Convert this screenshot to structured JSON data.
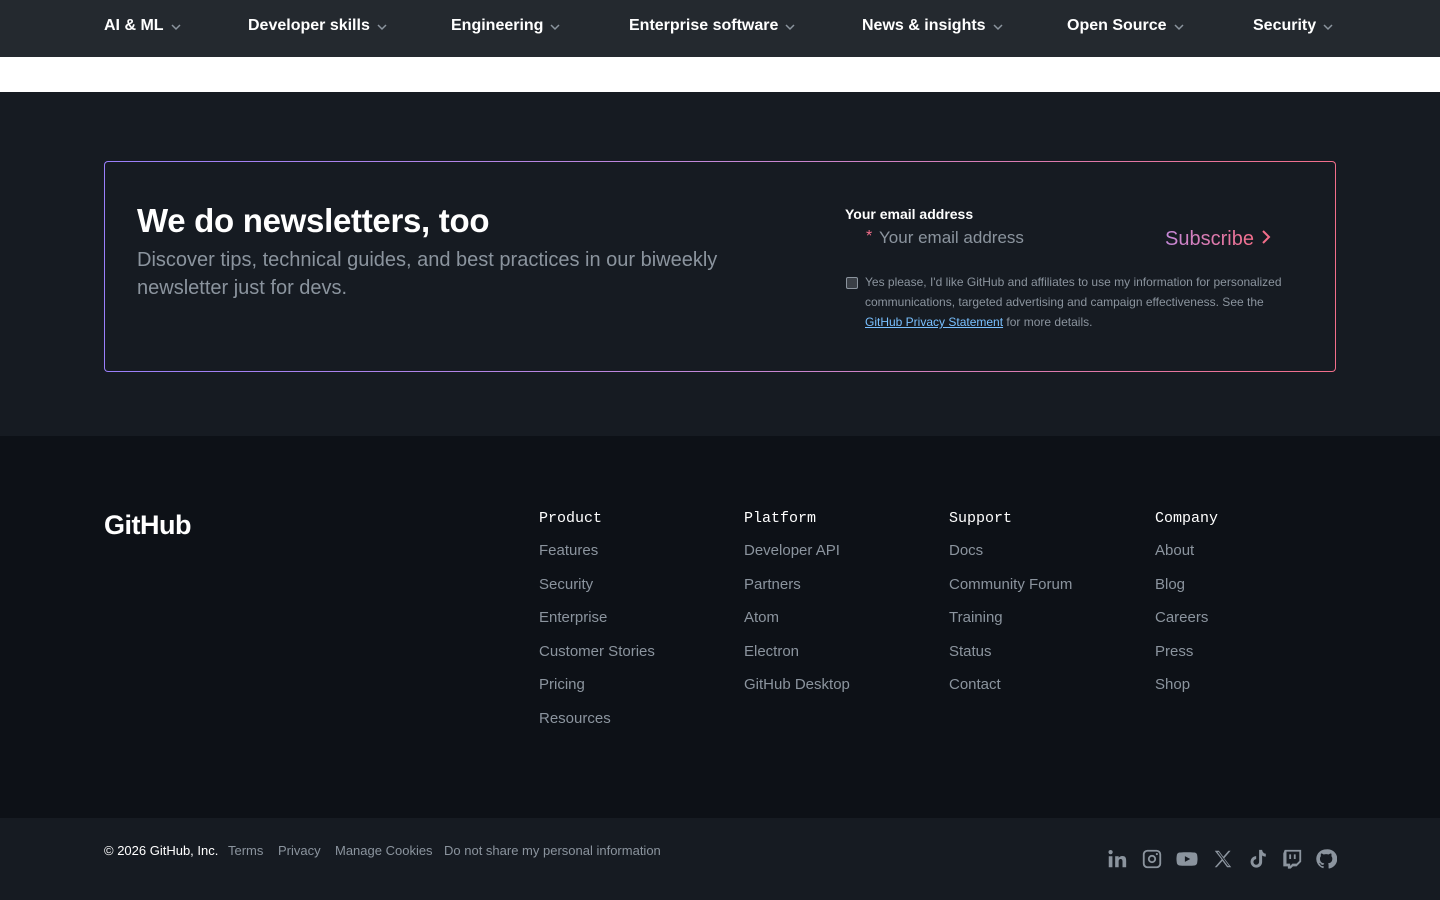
{
  "nav": {
    "items": [
      {
        "label": "AI & ML"
      },
      {
        "label": "Developer skills"
      },
      {
        "label": "Engineering"
      },
      {
        "label": "Enterprise software"
      },
      {
        "label": "News & insights"
      },
      {
        "label": "Open Source"
      },
      {
        "label": "Security"
      }
    ]
  },
  "newsletter": {
    "title": "We do newsletters, too",
    "description": "Discover tips, technical guides, and best practices in our biweekly newsletter just for devs.",
    "email_label": "Your email address",
    "required_mark": "*",
    "email_placeholder": "Your email address",
    "subscribe_label": "Subscribe",
    "consent_text": "Yes please, I'd like GitHub and affiliates to use my information for personalized communications, targeted advertising and campaign effectiveness. See the",
    "consent_link": "GitHub Privacy Statement",
    "consent_suffix": "for more details.",
    "consent_checked": false
  },
  "footer": {
    "logo": "GitHub",
    "columns": [
      {
        "heading": "Product",
        "links": [
          "Features",
          "Security",
          "Enterprise",
          "Customer Stories",
          "Pricing",
          "Resources"
        ]
      },
      {
        "heading": "Platform",
        "links": [
          "Developer API",
          "Partners",
          "Atom",
          "Electron",
          "GitHub Desktop"
        ]
      },
      {
        "heading": "Support",
        "links": [
          "Docs",
          "Community Forum",
          "Training",
          "Status",
          "Contact"
        ]
      },
      {
        "heading": "Company",
        "links": [
          "About",
          "Blog",
          "Careers",
          "Press",
          "Shop"
        ]
      }
    ]
  },
  "bottom": {
    "copyright": "© 2026 GitHub, Inc.",
    "legal_links": [
      "Terms",
      "Privacy",
      "Manage Cookies",
      "Do not share my personal information"
    ],
    "social_icons": [
      "linkedin-icon",
      "instagram-icon",
      "youtube-icon",
      "x-icon",
      "tiktok-icon",
      "twitch-icon",
      "github-icon"
    ]
  },
  "colors": {
    "page_bg": "#161b22",
    "footer_bg": "#0d1117",
    "nav_bg": "#24292f",
    "muted_text": "#8b949e",
    "accent_purple": "#c488d8",
    "accent_pink": "#f26e8a",
    "link_blue": "#79c0ff"
  }
}
